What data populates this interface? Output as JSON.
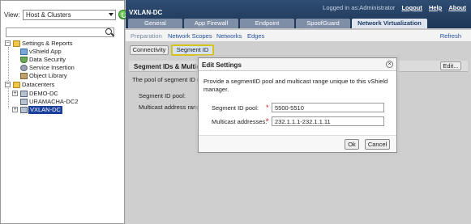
{
  "left_pane": {
    "view_label": "View:",
    "view_value": "Host & Clusters",
    "search_placeholder": "",
    "tree": {
      "settings_reports": "Settings & Reports",
      "vshield_app": "vShield App",
      "data_security": "Data Security",
      "service_insertion": "Service Insertion",
      "object_library": "Object Library",
      "datacenters": "Datacenters",
      "demo_dc": "DEMO-DC",
      "uramacha_dc2": "URAMACHA-DC2",
      "vxlan_dc": "VXLAN-DC"
    }
  },
  "header": {
    "title": "VXLAN-DC",
    "logged_in_text": "Logged in as:Administrator",
    "logout": "Logout",
    "help": "Help",
    "about": "About"
  },
  "tabs": [
    {
      "label": "General"
    },
    {
      "label": "App Firewall"
    },
    {
      "label": "Endpoint"
    },
    {
      "label": "SpoofGuard"
    },
    {
      "label": "Network Virtualization"
    }
  ],
  "subnav": {
    "preparation": "Preparation",
    "network_scopes": "Network Scopes",
    "networks": "Networks",
    "edges": "Edges",
    "refresh": "Refresh"
  },
  "content": {
    "connectivity_btn": "Connectivity",
    "segment_id_btn": "Segment ID",
    "section_title": "Segment IDs & Multica",
    "edit_btn": "Edit...",
    "pool_text": "The pool of segment ID u",
    "segment_id_pool_label": "Segment ID pool:",
    "multicast_label": "Multicast address rang"
  },
  "dialog": {
    "title": "Edit Settings",
    "close_symbol": "×",
    "description": "Provide a segmentID pool and multicast range unique to this vShield manager.",
    "segment_pool_label": "Segment ID pool:",
    "segment_pool_value": "5500-5510",
    "multicast_label": "Multicast addresses:",
    "multicast_value": "232.1.1.1-232.1.1.11",
    "required_marker": "*",
    "ok": "Ok",
    "cancel": "Cancel"
  },
  "colors": {
    "topbar": "#2f4d73",
    "active_tab": "#dfe6f0",
    "selected_tree": "#1b3f9c",
    "highlight_border": "#d6c21a",
    "required": "#d01818"
  }
}
